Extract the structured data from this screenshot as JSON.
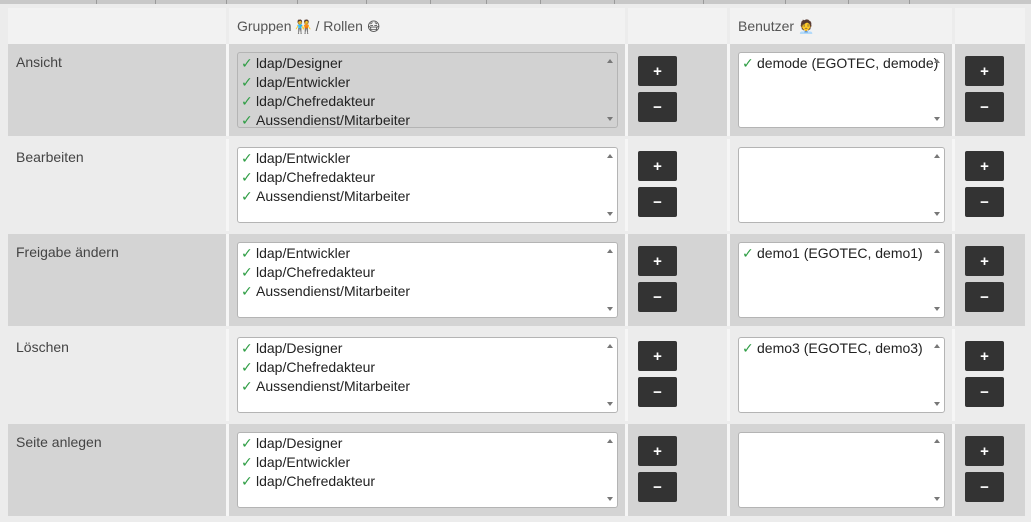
{
  "header": {
    "groups_label": "Gruppen",
    "groups_emoji": "🧑‍🤝‍🧑",
    "roles_label": "/ Rollen",
    "roles_emoji": "😷",
    "users_label": "Benutzer",
    "users_emoji": "🧑‍💼"
  },
  "check_symbol": "✓",
  "buttons": {
    "add": "+",
    "remove": "−"
  },
  "permissions": [
    {
      "label": "Ansicht",
      "groups": [
        "ldap/Designer",
        "ldap/Entwickler",
        "ldap/Chefredakteur",
        "Aussendienst/Mitarbeiter"
      ],
      "groups_selected": true,
      "users": [
        "demode (EGOTEC, demode)"
      ]
    },
    {
      "label": "Bearbeiten",
      "groups": [
        "ldap/Entwickler",
        "ldap/Chefredakteur",
        "Aussendienst/Mitarbeiter"
      ],
      "groups_selected": false,
      "users": []
    },
    {
      "label": "Freigabe ändern",
      "groups": [
        "ldap/Entwickler",
        "ldap/Chefredakteur",
        "Aussendienst/Mitarbeiter"
      ],
      "groups_selected": false,
      "users": [
        "demo1 (EGOTEC, demo1)"
      ]
    },
    {
      "label": "Löschen",
      "groups": [
        "ldap/Designer",
        "ldap/Chefredakteur",
        "Aussendienst/Mitarbeiter"
      ],
      "groups_selected": false,
      "users": [
        "demo3 (EGOTEC, demo3)"
      ]
    },
    {
      "label": "Seite anlegen",
      "groups": [
        "ldap/Designer",
        "ldap/Entwickler",
        "ldap/Chefredakteur"
      ],
      "groups_selected": false,
      "users": []
    }
  ]
}
